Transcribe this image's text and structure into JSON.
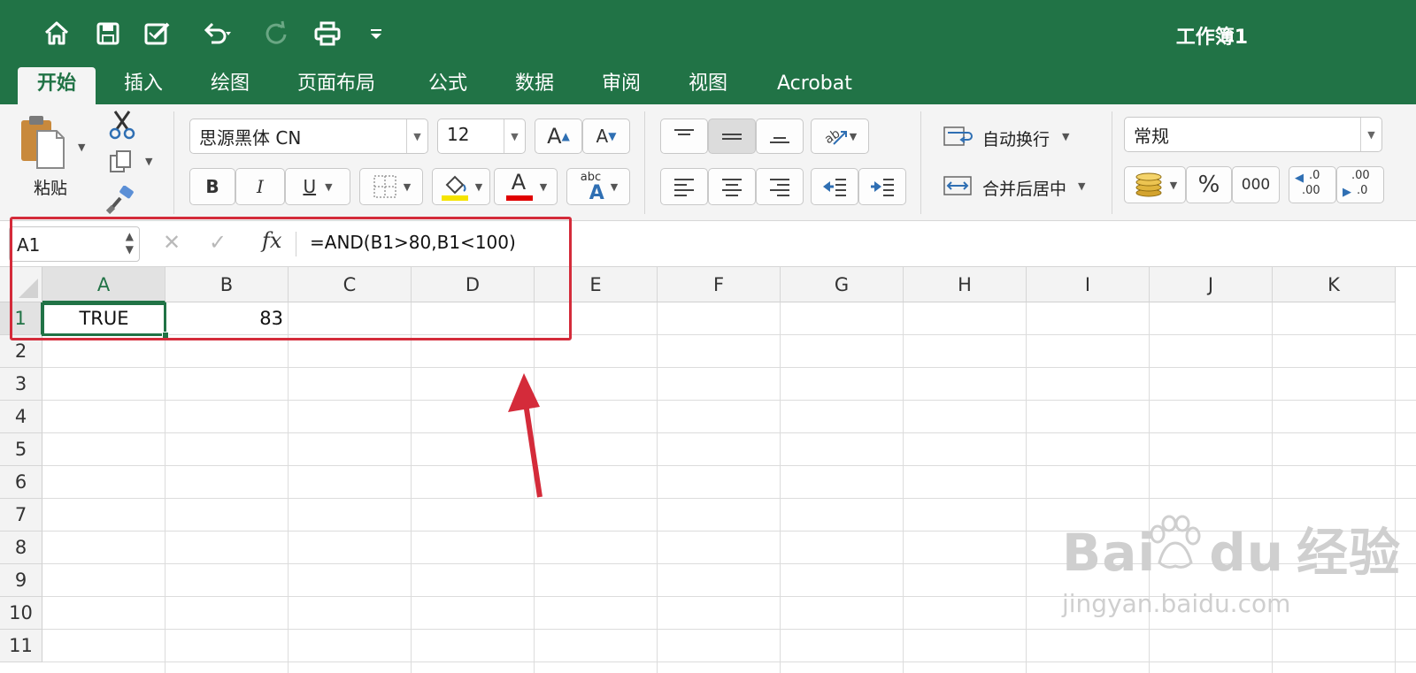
{
  "titlebar": {
    "document_title": "工作簿1",
    "icons": [
      "home-icon",
      "save-icon",
      "edit-icon",
      "undo-icon",
      "redo-icon",
      "print-icon",
      "customize-icon"
    ]
  },
  "tabs": [
    {
      "label": "开始",
      "active": true
    },
    {
      "label": "插入"
    },
    {
      "label": "绘图"
    },
    {
      "label": "页面布局"
    },
    {
      "label": "公式"
    },
    {
      "label": "数据"
    },
    {
      "label": "审阅"
    },
    {
      "label": "视图"
    },
    {
      "label": "Acrobat"
    }
  ],
  "ribbon": {
    "paste_label": "粘贴",
    "font_name": "思源黑体 CN",
    "font_size": "12",
    "bold": "B",
    "italic": "I",
    "underline": "U",
    "font_color_glyph": "A",
    "grow_font": "A",
    "shrink_font": "A",
    "phonetic_small": "abc",
    "phonetic_big": "A",
    "wrap_text": "自动换行",
    "merge_center": "合并后居中",
    "number_format": "常规",
    "percent": "%",
    "comma": "000",
    "increase_decimal_top": ".0",
    "increase_decimal_bottom": ".00",
    "decrease_decimal_top": ".00",
    "decrease_decimal_bottom": ".0"
  },
  "formula_bar": {
    "name_box": "A1",
    "fx_label": "fx",
    "formula": "=AND(B1>80,B1<100)"
  },
  "sheet": {
    "columns": [
      "A",
      "B",
      "C",
      "D",
      "E",
      "F",
      "G",
      "H",
      "I",
      "J",
      "K"
    ],
    "rows": [
      "1",
      "2",
      "3",
      "4",
      "5",
      "6",
      "7",
      "8",
      "9",
      "10",
      "11"
    ],
    "active_cell": "A1",
    "cells": {
      "A1": "TRUE",
      "B1": "83"
    }
  },
  "watermark": {
    "brand": "Bai",
    "brand2": "du",
    "brand_cn": "经验",
    "url": "jingyan.baidu.com"
  },
  "colors": {
    "excel_green": "#217346",
    "annotation_red": "#d42b3a"
  }
}
